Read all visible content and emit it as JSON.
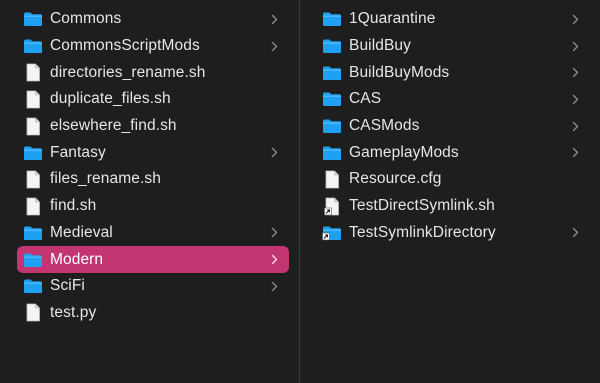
{
  "columns": [
    {
      "items": [
        {
          "label": "Commons",
          "type": "folder",
          "icon": "folder-icon",
          "chevron": true
        },
        {
          "label": "CommonsScriptMods",
          "type": "folder",
          "icon": "folder-icon",
          "chevron": true
        },
        {
          "label": "directories_rename.sh",
          "type": "file",
          "icon": "document-icon",
          "chevron": false
        },
        {
          "label": "duplicate_files.sh",
          "type": "file",
          "icon": "document-icon",
          "chevron": false
        },
        {
          "label": "elsewhere_find.sh",
          "type": "file",
          "icon": "document-icon",
          "chevron": false
        },
        {
          "label": "Fantasy",
          "type": "folder",
          "icon": "folder-icon",
          "chevron": true
        },
        {
          "label": "files_rename.sh",
          "type": "file",
          "icon": "document-icon",
          "chevron": false
        },
        {
          "label": "find.sh",
          "type": "file",
          "icon": "document-icon",
          "chevron": false
        },
        {
          "label": "Medieval",
          "type": "folder",
          "icon": "folder-icon",
          "chevron": true
        },
        {
          "label": "Modern",
          "type": "folder",
          "icon": "folder-icon",
          "chevron": true,
          "selected": true
        },
        {
          "label": "SciFi",
          "type": "folder",
          "icon": "folder-icon",
          "chevron": true
        },
        {
          "label": "test.py",
          "type": "file",
          "icon": "document-icon",
          "chevron": false
        }
      ]
    },
    {
      "items": [
        {
          "label": "1Quarantine",
          "type": "folder",
          "icon": "folder-icon",
          "chevron": true
        },
        {
          "label": "BuildBuy",
          "type": "folder",
          "icon": "folder-icon",
          "chevron": true
        },
        {
          "label": "BuildBuyMods",
          "type": "folder",
          "icon": "folder-icon",
          "chevron": true
        },
        {
          "label": "CAS",
          "type": "folder",
          "icon": "folder-icon",
          "chevron": true
        },
        {
          "label": "CASMods",
          "type": "folder",
          "icon": "folder-icon",
          "chevron": true
        },
        {
          "label": "GameplayMods",
          "type": "folder",
          "icon": "folder-icon",
          "chevron": true
        },
        {
          "label": "Resource.cfg",
          "type": "file",
          "icon": "document-icon",
          "chevron": false
        },
        {
          "label": "TestDirectSymlink.sh",
          "type": "symlink-file",
          "icon": "alias-document-icon",
          "chevron": false
        },
        {
          "label": "TestSymlinkDirectory",
          "type": "symlink-folder",
          "icon": "alias-folder-icon",
          "chevron": true
        }
      ]
    }
  ],
  "colors": {
    "background": "#1e1e1e",
    "selection": "#c33571",
    "folder": "#1ea1f2",
    "text": "#e6e6e6",
    "chevron": "#8a8a8a"
  }
}
